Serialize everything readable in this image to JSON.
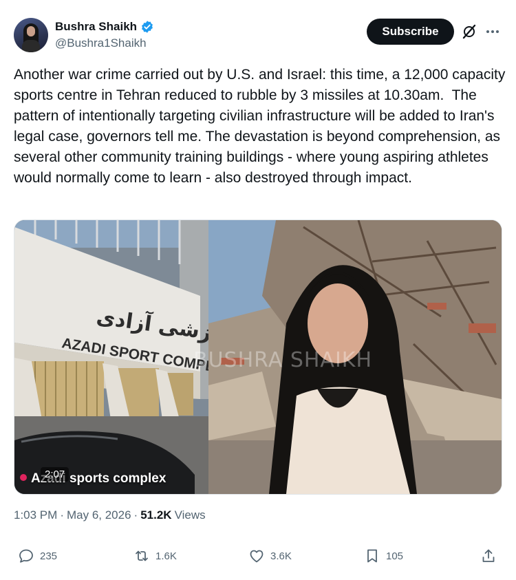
{
  "author": {
    "display_name": "Bushra Shaikh",
    "handle": "@Bushra1Shaikh",
    "verified": true
  },
  "header": {
    "subscribe_label": "Subscribe",
    "grok_icon": "grok-icon",
    "more_icon": "more-icon"
  },
  "tweet": {
    "text": "Another war crime carried out by U.S. and Israel: this time, a 12,000 capacity sports centre in Tehran reduced to rubble by 3 missiles at 10.30am.  The pattern of intentionally targeting civilian infrastructure will be added to Iran's legal case, governors tell me. The devastation is beyond comprehension, as several other community training buildings - where young aspiring athletes would normally come to learn - also destroyed through impact."
  },
  "media": {
    "sign_farsi": "مجموعه ورزشی آزادی",
    "sign_english": "AZADI SPORT COMPLEX",
    "watermark": "BUSHRA SHAIKH",
    "caption": "Azadi sports complex",
    "duration": "2:07"
  },
  "meta": {
    "time": "1:03 PM",
    "separator": "·",
    "date": "May 6, 2026",
    "views_count": "51.2K",
    "views_label": "Views"
  },
  "actions": {
    "replies": "235",
    "reposts": "1.6K",
    "likes": "3.6K",
    "bookmarks": "105"
  },
  "colors": {
    "primary_text": "#0f1419",
    "secondary_text": "#536471",
    "verified": "#1d9bf0",
    "subscribe_bg": "#0f1419"
  }
}
